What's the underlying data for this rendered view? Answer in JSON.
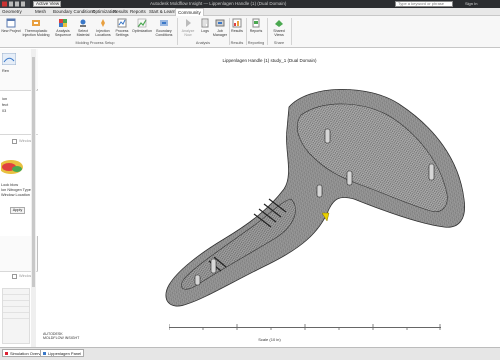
{
  "titlebar": {
    "view_box": "Active View",
    "title": "Autodesk Moldflow Insight — Lippenlagen Handle (1) (Dual Domain)",
    "search_placeholder": "Type a keyword or phrase",
    "user": "Sign In"
  },
  "tabs": [
    {
      "label": "Geometry"
    },
    {
      "label": "Mesh"
    },
    {
      "label": "Boundary Conditions"
    },
    {
      "label": "Optimization"
    },
    {
      "label": "Results"
    },
    {
      "label": "Reports"
    },
    {
      "label": "Start & Learn"
    },
    {
      "label": "Community"
    }
  ],
  "active_tab": "Community",
  "ribbon": {
    "buttons": [
      {
        "label": "New Project"
      },
      {
        "label": "Thermoplastic Injection Molding"
      },
      {
        "label": "Analysis Sequence"
      },
      {
        "label": "Select Material"
      },
      {
        "label": "Injection Locations"
      },
      {
        "label": "Process Settings"
      },
      {
        "label": "Optimization"
      },
      {
        "label": "Boundary Conditions"
      },
      {
        "label": "Analyze Now"
      },
      {
        "label": "Logs"
      },
      {
        "label": "Job Manager"
      },
      {
        "label": "Results"
      },
      {
        "label": "Reports"
      },
      {
        "label": "Shared Views"
      }
    ],
    "groups": [
      {
        "label": "Molding Process Setup"
      },
      {
        "label": "Analysis"
      },
      {
        "label": "Results"
      },
      {
        "label": "Reporting"
      },
      {
        "label": "Share"
      }
    ]
  },
  "left_panel": {
    "lines": [
      "Ren",
      "ion",
      "fect",
      "03",
      "Window",
      "Look blow",
      "Ion Nitrogen Type",
      "Window Location B"
    ],
    "window_label": "Window",
    "apply_button": "Apply"
  },
  "viewport": {
    "title": "Lippenlagen Handle (1) study_1 (Dual Domain)",
    "scale_label": "Scale (10 in)",
    "logo_line1": "AUTODESK",
    "logo_line2": "MOLDFLOW INSIGHT"
  },
  "statusbar": {
    "tabs": [
      {
        "label": "Simulation Overview"
      },
      {
        "label": "Lippenlagen Panel"
      }
    ]
  },
  "colors": {
    "titlebar": "#2b2d30",
    "ribbon": "#f7f7f7",
    "accent_orange": "#e8a040",
    "accent_green": "#4aa850",
    "accent_blue": "#3a78c8"
  }
}
